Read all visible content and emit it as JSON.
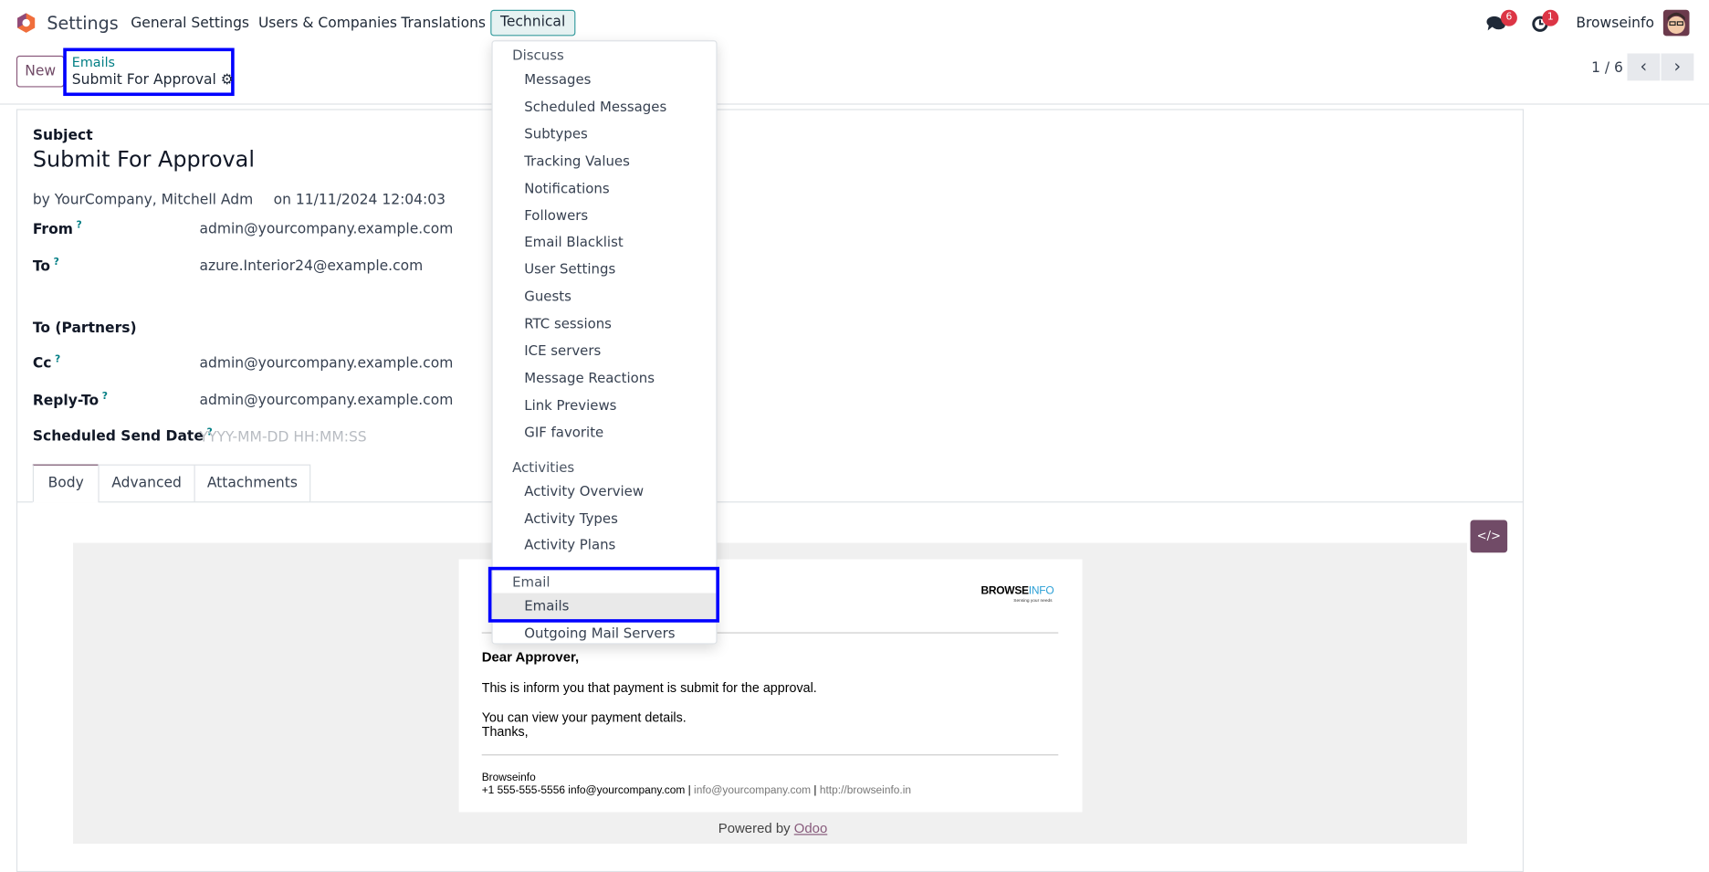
{
  "navbar": {
    "app_name": "Settings",
    "menus": [
      "General Settings",
      "Users & Companies",
      "Translations",
      "Technical"
    ],
    "messages_badge": "6",
    "activity_badge": "1",
    "user_name": "Browseinfo"
  },
  "control": {
    "new_label": "New",
    "breadcrumb_parent": "Emails",
    "breadcrumb_current": "Submit For Approval",
    "pager": "1 / 6"
  },
  "form": {
    "subject_label": "Subject",
    "subject": "Submit For Approval",
    "author": "by YourCompany, Mitchell Adm",
    "date": "on 11/11/2024 12:04:03",
    "fields": [
      {
        "label": "From",
        "help": "?",
        "value": "admin@yourcompany.example.com"
      },
      {
        "label": "To",
        "help": "?",
        "value": "azure.Interior24@example.com"
      },
      {
        "label": "To (Partners)",
        "help": "",
        "value": ""
      },
      {
        "label": "Cc",
        "help": "?",
        "value": "admin@yourcompany.example.com"
      },
      {
        "label": "Reply-To",
        "help": "?",
        "value": "admin@yourcompany.example.com"
      },
      {
        "label": "Scheduled Send Date",
        "help": "?",
        "placeholder": "YYYY-MM-DD HH:MM:SS"
      }
    ],
    "tabs": [
      "Body",
      "Advanced",
      "Attachments"
    ],
    "code_view_icon": "</>"
  },
  "email": {
    "logo_main": "BROWSE",
    "logo_accent": "INFO",
    "logo_tagline": "Sensing your needs",
    "greeting": "Dear Approver,",
    "line1": "This is inform you that payment is submit for the approval.",
    "line2": "You can view your payment details.",
    "line3": "Thanks,",
    "sig_company": "Browseinfo",
    "sig_phone": "+1 555-555-5556 info@yourcompany.com |",
    "sig_email": "info@yourcompany.com",
    "sig_sep": "|",
    "sig_web": "http://browseinfo.in",
    "powered_by": "Powered by",
    "odoo_link": "Odoo"
  },
  "dropdown": {
    "sections": [
      {
        "header": "Discuss",
        "items": [
          "Messages",
          "Scheduled Messages",
          "Subtypes",
          "Tracking Values",
          "Notifications",
          "Followers",
          "Email Blacklist",
          "User Settings",
          "Guests",
          "RTC sessions",
          "ICE servers",
          "Message Reactions",
          "Link Previews",
          "GIF favorite"
        ]
      },
      {
        "header": "Activities",
        "items": [
          "Activity Overview",
          "Activity Types",
          "Activity Plans"
        ]
      },
      {
        "header": "Email",
        "items": [
          "Emails",
          "Outgoing Mail Servers"
        ]
      }
    ]
  },
  "colors": {
    "brand": "#714b67",
    "teal": "#017e84",
    "highlight": "#0000ff"
  }
}
